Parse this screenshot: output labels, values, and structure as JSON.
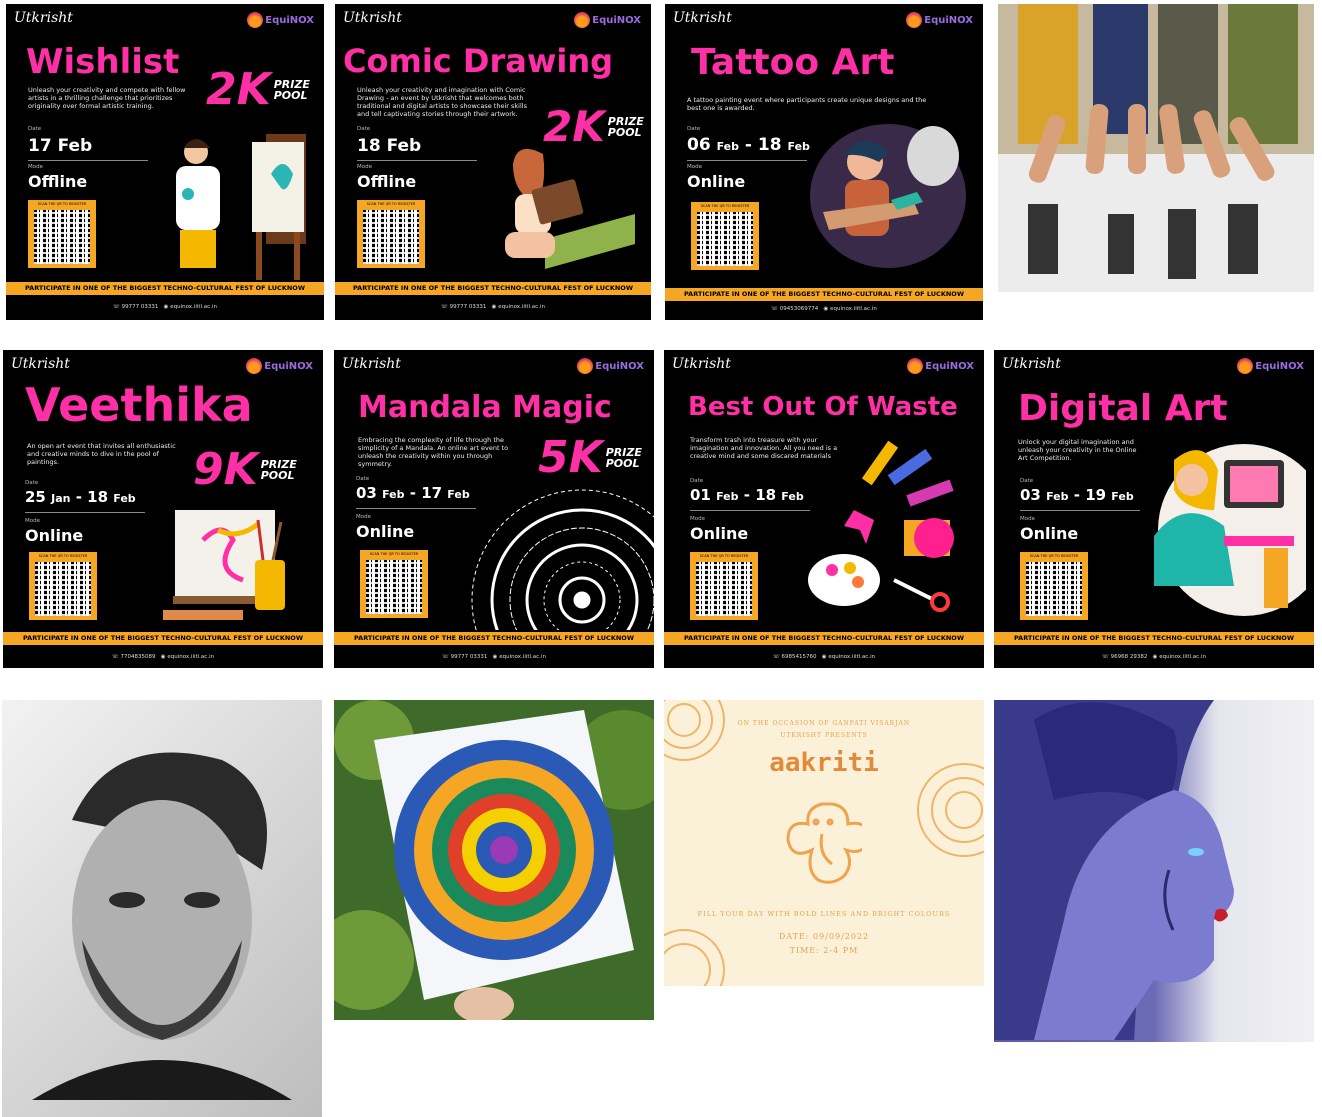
{
  "posters": [
    {
      "id": "wishlist",
      "club": "Utkrisht",
      "fest": "EquiNOX",
      "title": "Wishlist",
      "prize": "2K",
      "prize_label": "PRIZE POOL",
      "description": "Unleash your creativity and compete with fellow artists in a thrilling challenge that prioritizes originality over formal artistic training.",
      "date_label": "Date",
      "date": "17 Feb",
      "mode_label": "Mode",
      "mode": "Offline",
      "qr_label": "SCAN THE QR TO REGISTER",
      "banner": "PARTICIPATE IN ONE OF THE BIGGEST TECHNO-CULTURAL FEST OF LUCKNOW",
      "phone": "99777 03331",
      "website": "equinox.iiitl.ac.in"
    },
    {
      "id": "comic-drawing",
      "club": "Utkrisht",
      "fest": "EquiNOX",
      "title": "Comic Drawing",
      "prize": "2K",
      "prize_label": "PRIZE POOL",
      "description": "Unleash your creativity and imagination with Comic Drawing - an event by Utkrisht that welcomes both traditional and digital artists to showcase their skills and tell captivating stories through their artwork.",
      "date_label": "Date",
      "date": "18 Feb",
      "mode_label": "Mode",
      "mode": "Offline",
      "qr_label": "SCAN THE QR TO REGISTER",
      "banner": "PARTICIPATE IN ONE OF THE BIGGEST TECHNO-CULTURAL FEST OF LUCKNOW",
      "phone": "99777 03331",
      "website": "equinox.iiitl.ac.in"
    },
    {
      "id": "tattoo-art",
      "club": "Utkrisht",
      "fest": "EquiNOX",
      "title": "Tattoo Art",
      "prize": "",
      "prize_label": "",
      "description": "A tattoo painting event where participants create unique designs and the best one is awarded.",
      "date_label": "Date",
      "date_start": "06",
      "date_start_month": "Feb",
      "date_end": "18",
      "date_end_month": "Feb",
      "mode_label": "Mode",
      "mode": "Online",
      "qr_label": "SCAN THE QR TO REGISTER",
      "banner": "PARTICIPATE IN ONE OF THE BIGGEST TECHNO-CULTURAL FEST OF LUCKNOW",
      "phone": "09453069774",
      "website": "equinox.iiitl.ac.in"
    },
    {
      "id": "veethika",
      "club": "Utkrisht",
      "fest": "EquiNOX",
      "title": "Veethika",
      "prize": "9K",
      "prize_label": "PRIZE POOL",
      "description": "An open art event that invites all enthusiastic and creative minds to dive in the pool of paintings.",
      "date_label": "Date",
      "date_start": "25",
      "date_start_month": "Jan",
      "date_end": "18",
      "date_end_month": "Feb",
      "mode_label": "Mode",
      "mode": "Online",
      "qr_label": "SCAN THE QR TO REGISTER",
      "banner": "PARTICIPATE IN ONE OF THE BIGGEST TECHNO-CULTURAL FEST OF LUCKNOW",
      "phone": "7704835089",
      "website": "equinox.iiitl.ac.in"
    },
    {
      "id": "mandala-magic",
      "club": "Utkrisht",
      "fest": "EquiNOX",
      "title": "Mandala Magic",
      "prize": "5K",
      "prize_label": "PRIZE POOL",
      "description": "Embracing the complexity of life through the simplicity of a Mandala. An online art event to unleash the creativity within you through symmetry.",
      "date_label": "Date",
      "date_start": "03",
      "date_start_month": "Feb",
      "date_end": "17",
      "date_end_month": "Feb",
      "mode_label": "Mode",
      "mode": "Online",
      "qr_label": "SCAN THE QR TO REGISTER",
      "banner": "PARTICIPATE IN ONE OF THE BIGGEST TECHNO-CULTURAL FEST OF LUCKNOW",
      "phone": "99777 03331",
      "website": "equinox.iiitl.ac.in"
    },
    {
      "id": "best-out-of-waste",
      "club": "Utkrisht",
      "fest": "EquiNOX",
      "title": "Best Out Of Waste",
      "prize": "",
      "prize_label": "",
      "description": "Transform trash into treasure with your imagination and innovation. All you need is a creative mind and some discared materials",
      "date_label": "Date",
      "date_start": "01",
      "date_start_month": "Feb",
      "date_end": "18",
      "date_end_month": "Feb",
      "mode_label": "Mode",
      "mode": "Online",
      "qr_label": "SCAN THE QR TO REGISTER",
      "banner": "PARTICIPATE IN ONE OF THE BIGGEST TECHNO-CULTURAL FEST OF LUCKNOW",
      "phone": "6985415760",
      "website": "equinox.iiitl.ac.in"
    },
    {
      "id": "digital-art",
      "club": "Utkrisht",
      "fest": "EquiNOX",
      "title": "Digital Art",
      "prize": "",
      "prize_label": "",
      "description": "Unlock your digital imagination and unleash your creativity in the Online Art Competition.",
      "date_label": "Date",
      "date_start": "03",
      "date_start_month": "Feb",
      "date_end": "19",
      "date_end_month": "Feb",
      "mode_label": "Mode",
      "mode": "Online",
      "qr_label": "SCAN THE QR TO REGISTER",
      "banner": "PARTICIPATE IN ONE OF THE BIGGEST TECHNO-CULTURAL FEST OF LUCKNOW",
      "phone": "96968 29382",
      "website": "equinox.iiitl.ac.in"
    }
  ],
  "aakriti": {
    "occasion": "ON THE OCCASION OF GANPATI VISARJAN",
    "presents": "UTKRISHT PRESENTS",
    "title": "aakriti",
    "tagline": "FILL YOUR DAY WITH BOLD LINES AND BRIGHT COLOURS",
    "date": "DATE: 09/09/2022",
    "time": "TIME: 2-4 PM"
  },
  "colors": {
    "pink": "#ff2fa6",
    "orange": "#f5a623",
    "black": "#000000",
    "cream": "#fbf1d9"
  }
}
